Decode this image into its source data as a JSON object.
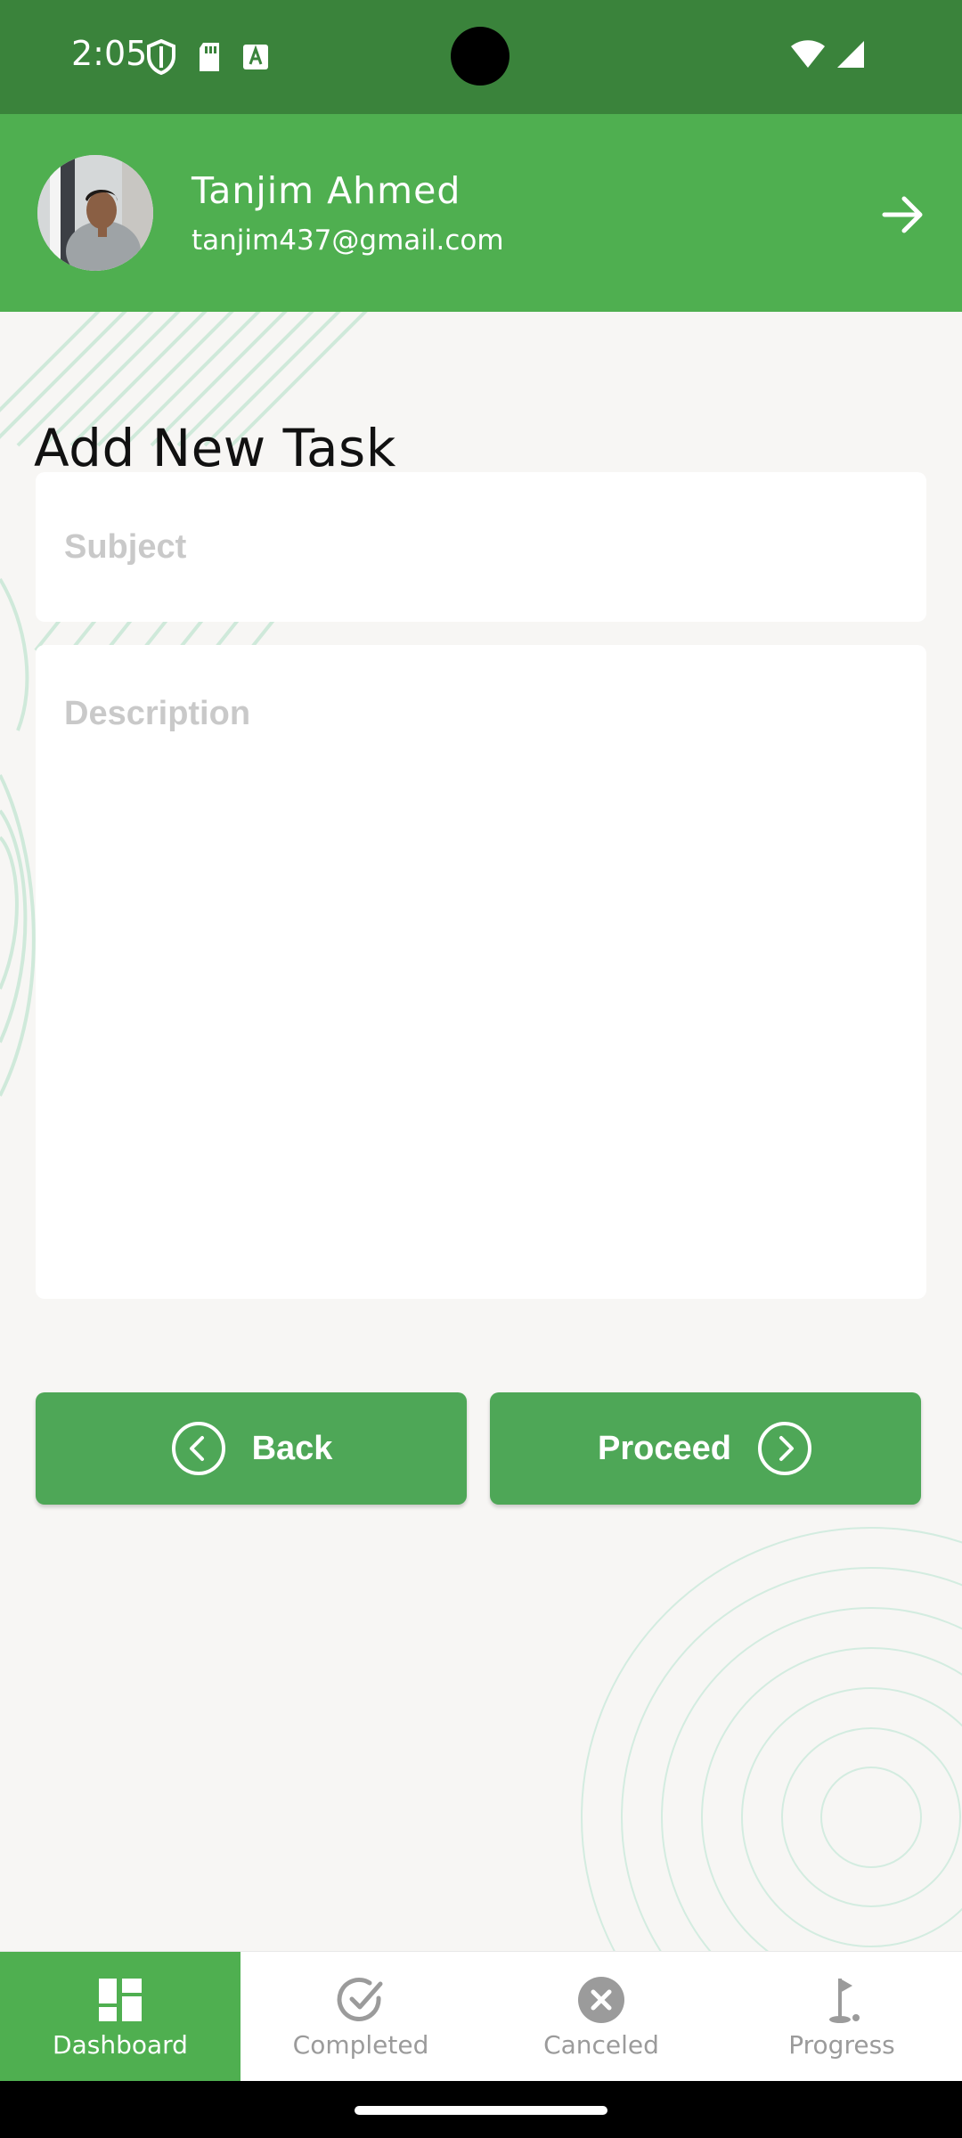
{
  "status_bar": {
    "time": "2:05"
  },
  "header": {
    "user_name": "Tanjim Ahmed",
    "user_email": "tanjim437@gmail.com"
  },
  "page": {
    "title": "Add New Task"
  },
  "form": {
    "subject_placeholder": "Subject",
    "subject_value": "",
    "description_placeholder": "Description",
    "description_value": ""
  },
  "buttons": {
    "back_label": "Back",
    "proceed_label": "Proceed"
  },
  "bottom_nav": {
    "items": [
      {
        "label": "Dashboard",
        "icon": "dashboard-icon",
        "active": true
      },
      {
        "label": "Completed",
        "icon": "check-circle-icon",
        "active": false
      },
      {
        "label": "Canceled",
        "icon": "cancel-circle-icon",
        "active": false
      },
      {
        "label": "Progress",
        "icon": "golf-flag-icon",
        "active": false
      }
    ]
  },
  "colors": {
    "status_bar": "#3a833b",
    "header": "#4faf50",
    "button": "#4ea757",
    "nav_active": "#4faf50",
    "background": "#f7f6f4"
  }
}
